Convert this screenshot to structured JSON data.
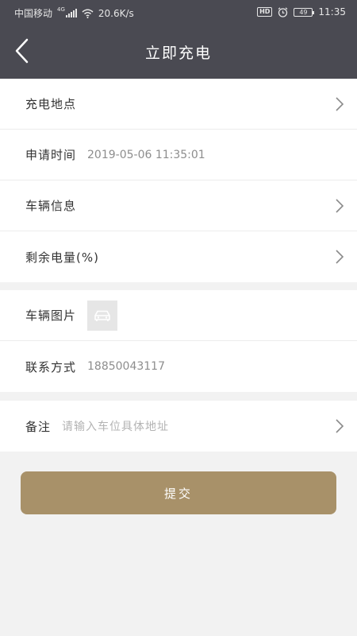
{
  "status_bar": {
    "carrier": "中国移动",
    "network": "4G",
    "speed": "20.6K/s",
    "hd": "HD",
    "battery": "49",
    "time": "11:35"
  },
  "nav": {
    "title": "立即充电",
    "back_icon": "chevron-left-icon"
  },
  "form": {
    "location": {
      "label": "充电地点"
    },
    "apply_time": {
      "label": "申请时间",
      "value": "2019-05-06 11:35:01"
    },
    "vehicle_info": {
      "label": "车辆信息"
    },
    "remaining_battery": {
      "label": "剩余电量(%)"
    },
    "vehicle_photo": {
      "label": "车辆图片",
      "icon": "car-icon"
    },
    "contact": {
      "label": "联系方式",
      "value": "18850043117"
    },
    "remark": {
      "label": "备注",
      "placeholder": "请输入车位具体地址"
    }
  },
  "submit_label": "提交",
  "colors": {
    "header": "#4a4a52",
    "accent": "#a89169",
    "background": "#f2f2f2"
  }
}
